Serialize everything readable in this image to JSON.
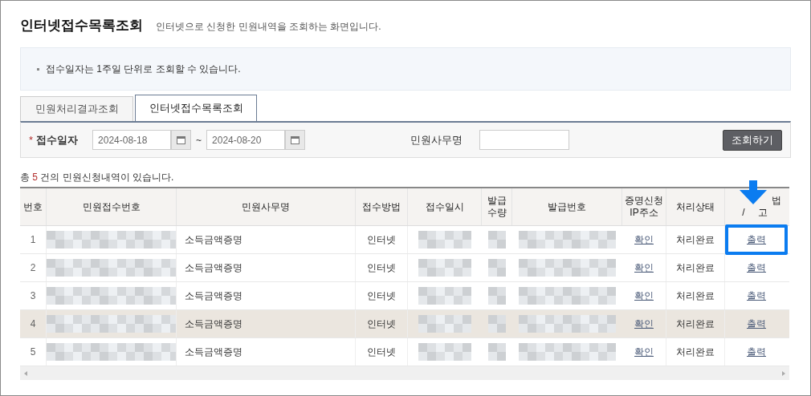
{
  "page": {
    "title": "인터넷접수목록조회",
    "subtitle": "인터넷으로 신청한 민원내역을 조회하는 화면입니다."
  },
  "notice": "접수일자는 1주일 단위로 조회할 수 있습니다.",
  "tabs": [
    {
      "label": "민원처리결과조회",
      "selected": false
    },
    {
      "label": "인터넷접수목록조회",
      "selected": true
    }
  ],
  "search": {
    "required_mark": "*",
    "date_label": "접수일자",
    "date_from": "2024-08-18",
    "separator": "~",
    "date_to": "2024-08-20",
    "name_label": "민원사무명",
    "search_button": "조회하기"
  },
  "count": {
    "before": "총",
    "number": "5",
    "after": "건의 민원신청내역이 있습니다."
  },
  "table": {
    "columns": [
      "번호",
      "민원접수번호",
      "민원사무명",
      "접수방법",
      "접수일시",
      "발급\n수량",
      "발급번호",
      "증명신청\nIP주소",
      "처리상태",
      "법\n/ 고"
    ],
    "rows": [
      {
        "no": "1",
        "office": "소득금액증명",
        "method": "인터넷",
        "ip": "확인",
        "status": "처리완료",
        "action": "출력",
        "selected": false,
        "marked": true
      },
      {
        "no": "2",
        "office": "소득금액증명",
        "method": "인터넷",
        "ip": "확인",
        "status": "처리완료",
        "action": "출력",
        "selected": false,
        "marked": false
      },
      {
        "no": "3",
        "office": "소득금액증명",
        "method": "인터넷",
        "ip": "확인",
        "status": "처리완료",
        "action": "출력",
        "selected": false,
        "marked": false
      },
      {
        "no": "4",
        "office": "소득금액증명",
        "method": "인터넷",
        "ip": "확인",
        "status": "처리완료",
        "action": "출력",
        "selected": true,
        "marked": false
      },
      {
        "no": "5",
        "office": "소득금액증명",
        "method": "인터넷",
        "ip": "확인",
        "status": "처리완료",
        "action": "출력",
        "selected": false,
        "marked": false
      }
    ]
  }
}
